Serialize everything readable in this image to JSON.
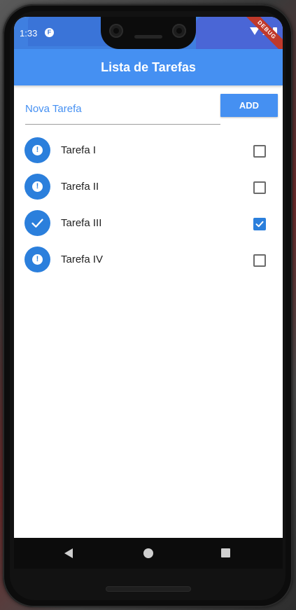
{
  "status_bar": {
    "time": "1:33",
    "debug_banner": "DEBUG",
    "icons": [
      "flutter-app-icon",
      "wifi-icon",
      "signal-icon",
      "battery-icon"
    ]
  },
  "app_bar": {
    "title": "Lista de Tarefas",
    "color": "#4590f2"
  },
  "new_task": {
    "placeholder": "Nova Tarefa",
    "value": "",
    "add_label": "ADD"
  },
  "tasks": [
    {
      "label": "Tarefa I",
      "done": false,
      "icon": "alert-icon"
    },
    {
      "label": "Tarefa II",
      "done": false,
      "icon": "alert-icon"
    },
    {
      "label": "Tarefa III",
      "done": true,
      "icon": "check-icon"
    },
    {
      "label": "Tarefa IV",
      "done": false,
      "icon": "alert-icon"
    }
  ],
  "nav_bar": {
    "icons": [
      "back-icon",
      "home-icon",
      "recents-icon"
    ]
  },
  "colors": {
    "accent": "#4590f2",
    "avatar": "#2b7fdc"
  }
}
